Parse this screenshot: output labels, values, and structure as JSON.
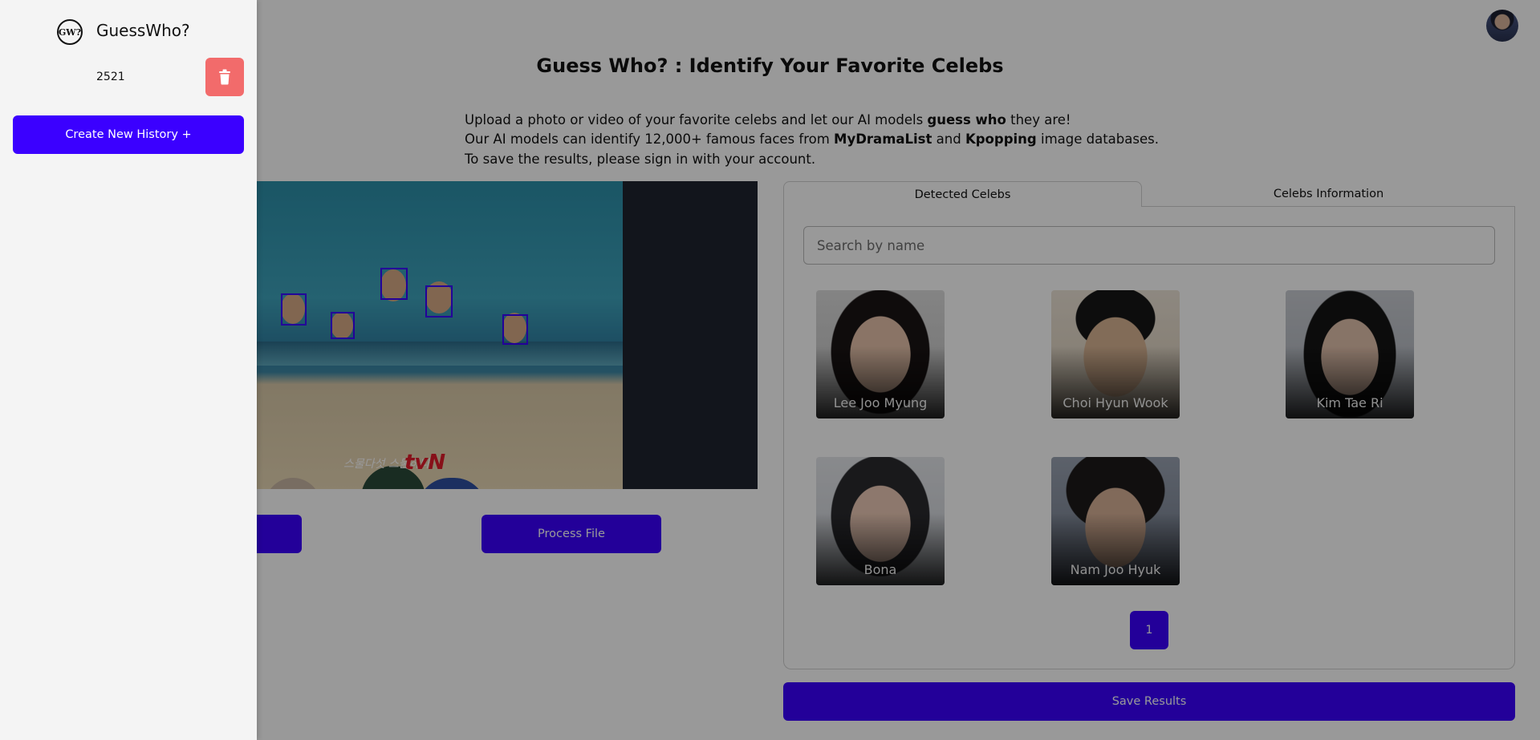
{
  "app": {
    "name": "GuessWho?",
    "logo_text": "GW?"
  },
  "header": {
    "title": "Guess Who? : Identify Your Favorite Celebs"
  },
  "description": {
    "line1_pre": "Upload a photo or video of your favorite celebs and let our AI models ",
    "line1_bold": "guess who",
    "line1_post": " they are!",
    "line2_pre": "Our AI models can identify 12,000+ famous faces from ",
    "line2_bold1": "MyDramaList",
    "line2_mid": " and ",
    "line2_bold2": "Kpopping",
    "line2_post": " image databases.",
    "line3": "To save the results, please sign in with your account."
  },
  "preview": {
    "watermark": "tvN",
    "signature": "스물다섯 스물하나"
  },
  "actions": {
    "upload_label": "",
    "process_label": "Process File",
    "save_label": "Save Results"
  },
  "tabs": [
    {
      "label": "Detected Celebs",
      "active": true
    },
    {
      "label": "Celebs Information",
      "active": false
    }
  ],
  "search": {
    "placeholder": "Search by name",
    "value": ""
  },
  "celebs": [
    {
      "name": "Lee Joo Myung"
    },
    {
      "name": "Choi Hyun Wook"
    },
    {
      "name": "Kim Tae Ri"
    },
    {
      "name": "Bona"
    },
    {
      "name": "Nam Joo Hyuk"
    }
  ],
  "pagination": {
    "current": "1"
  },
  "sidebar": {
    "history_item": "2521",
    "create_label": "Create New History +"
  },
  "colors": {
    "accent": "#3b00ff",
    "danger": "#f26b6b",
    "drawer_bg": "#f4f4f4"
  },
  "icons": {
    "trash": "trash-icon",
    "avatar": "user-avatar"
  }
}
